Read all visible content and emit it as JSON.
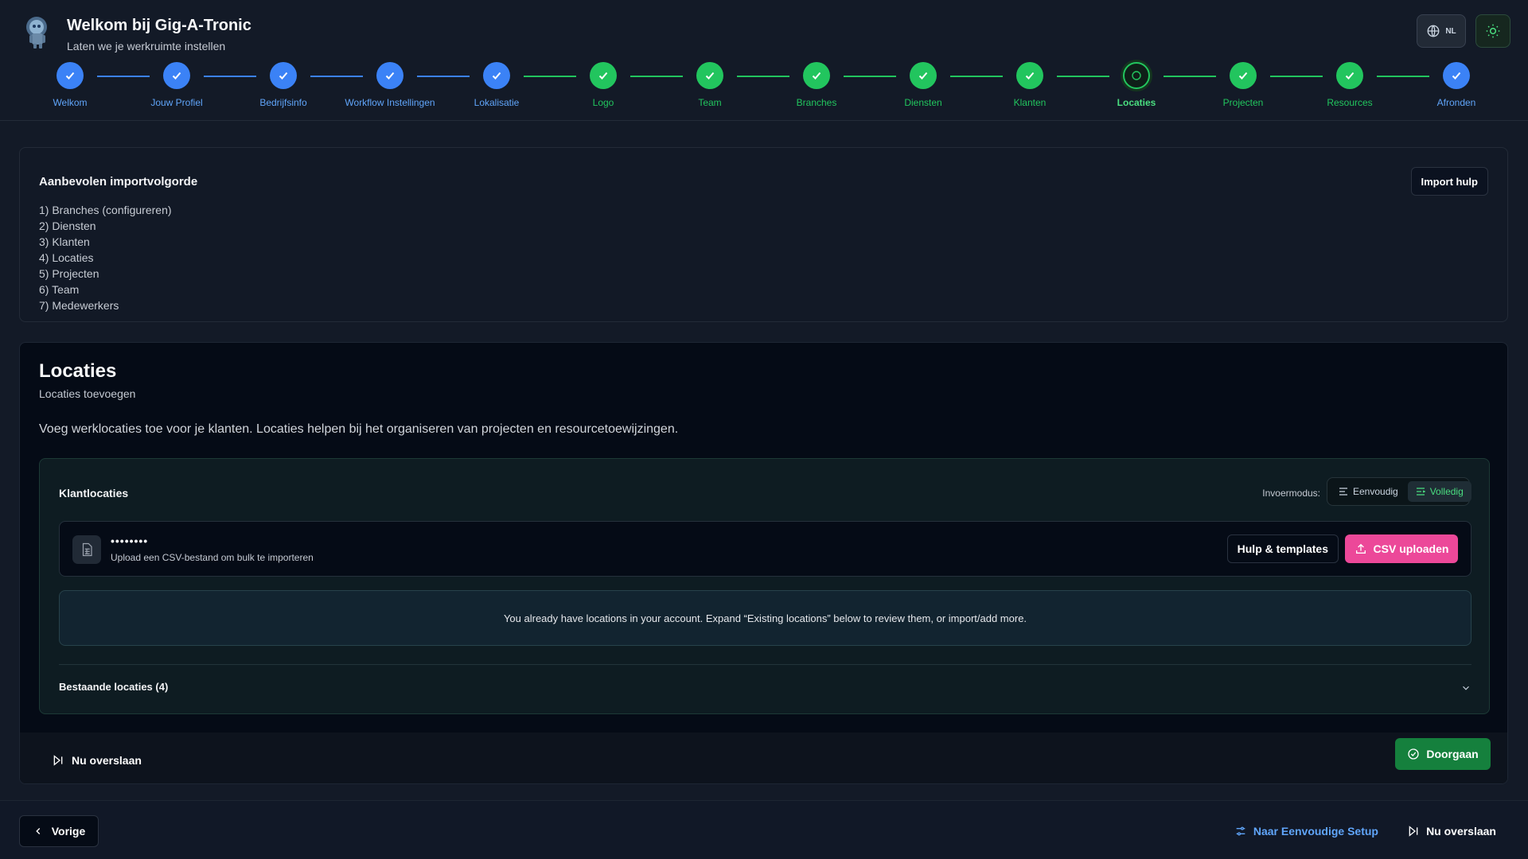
{
  "header": {
    "title": "Welkom bij Gig-A-Tronic",
    "subtitle": "Laten we je werkruimte instellen",
    "lang_code": "NL"
  },
  "colors": {
    "blue_step": "#3b82f6",
    "green_step": "#22c55e",
    "csv_button": "#ec4899",
    "continue_button": "#15803d"
  },
  "steps": [
    {
      "label": "Welkom",
      "state": "blue"
    },
    {
      "label": "Jouw Profiel",
      "state": "blue"
    },
    {
      "label": "Bedrijfsinfo",
      "state": "blue"
    },
    {
      "label": "Workflow Instellingen",
      "state": "blue"
    },
    {
      "label": "Lokalisatie",
      "state": "blue"
    },
    {
      "label": "Logo",
      "state": "green"
    },
    {
      "label": "Team",
      "state": "green"
    },
    {
      "label": "Branches",
      "state": "green"
    },
    {
      "label": "Diensten",
      "state": "green"
    },
    {
      "label": "Klanten",
      "state": "green"
    },
    {
      "label": "Locaties",
      "state": "current"
    },
    {
      "label": "Projecten",
      "state": "green"
    },
    {
      "label": "Resources",
      "state": "green"
    },
    {
      "label": "Afronden",
      "state": "blue"
    }
  ],
  "import_order": {
    "title": "Aanbevolen importvolgorde",
    "help_label": "Import hulp",
    "items": [
      "1) Branches (configureren)",
      "2) Diensten",
      "3) Klanten",
      "4) Locaties",
      "5) Projecten",
      "6) Team",
      "7) Medewerkers"
    ]
  },
  "locations": {
    "title": "Locaties",
    "subtitle": "Locaties toevoegen",
    "description": "Voeg werklocaties toe voor je klanten. Locaties helpen bij het organiseren van projecten en resourcetoewijzingen.",
    "panel_title": "Klantlocaties",
    "mode_label": "Invoermodus:",
    "mode_simple": "Eenvoudig",
    "mode_full": "Volledig",
    "active_mode": "Volledig",
    "upload_title": "••••••••",
    "upload_sub": "Upload een CSV-bestand om bulk te importeren",
    "help_templates": "Hulp & templates",
    "csv_upload": "CSV uploaden",
    "info": "You already have locations in your account. Expand “Existing locations” below to review them, or import/add more.",
    "existing_label": "Bestaande locaties (4)",
    "skip": "Nu overslaan",
    "continue": "Doorgaan"
  },
  "footer": {
    "prev": "Vorige",
    "simple_setup": "Naar Eenvoudige Setup",
    "skip": "Nu overslaan"
  }
}
